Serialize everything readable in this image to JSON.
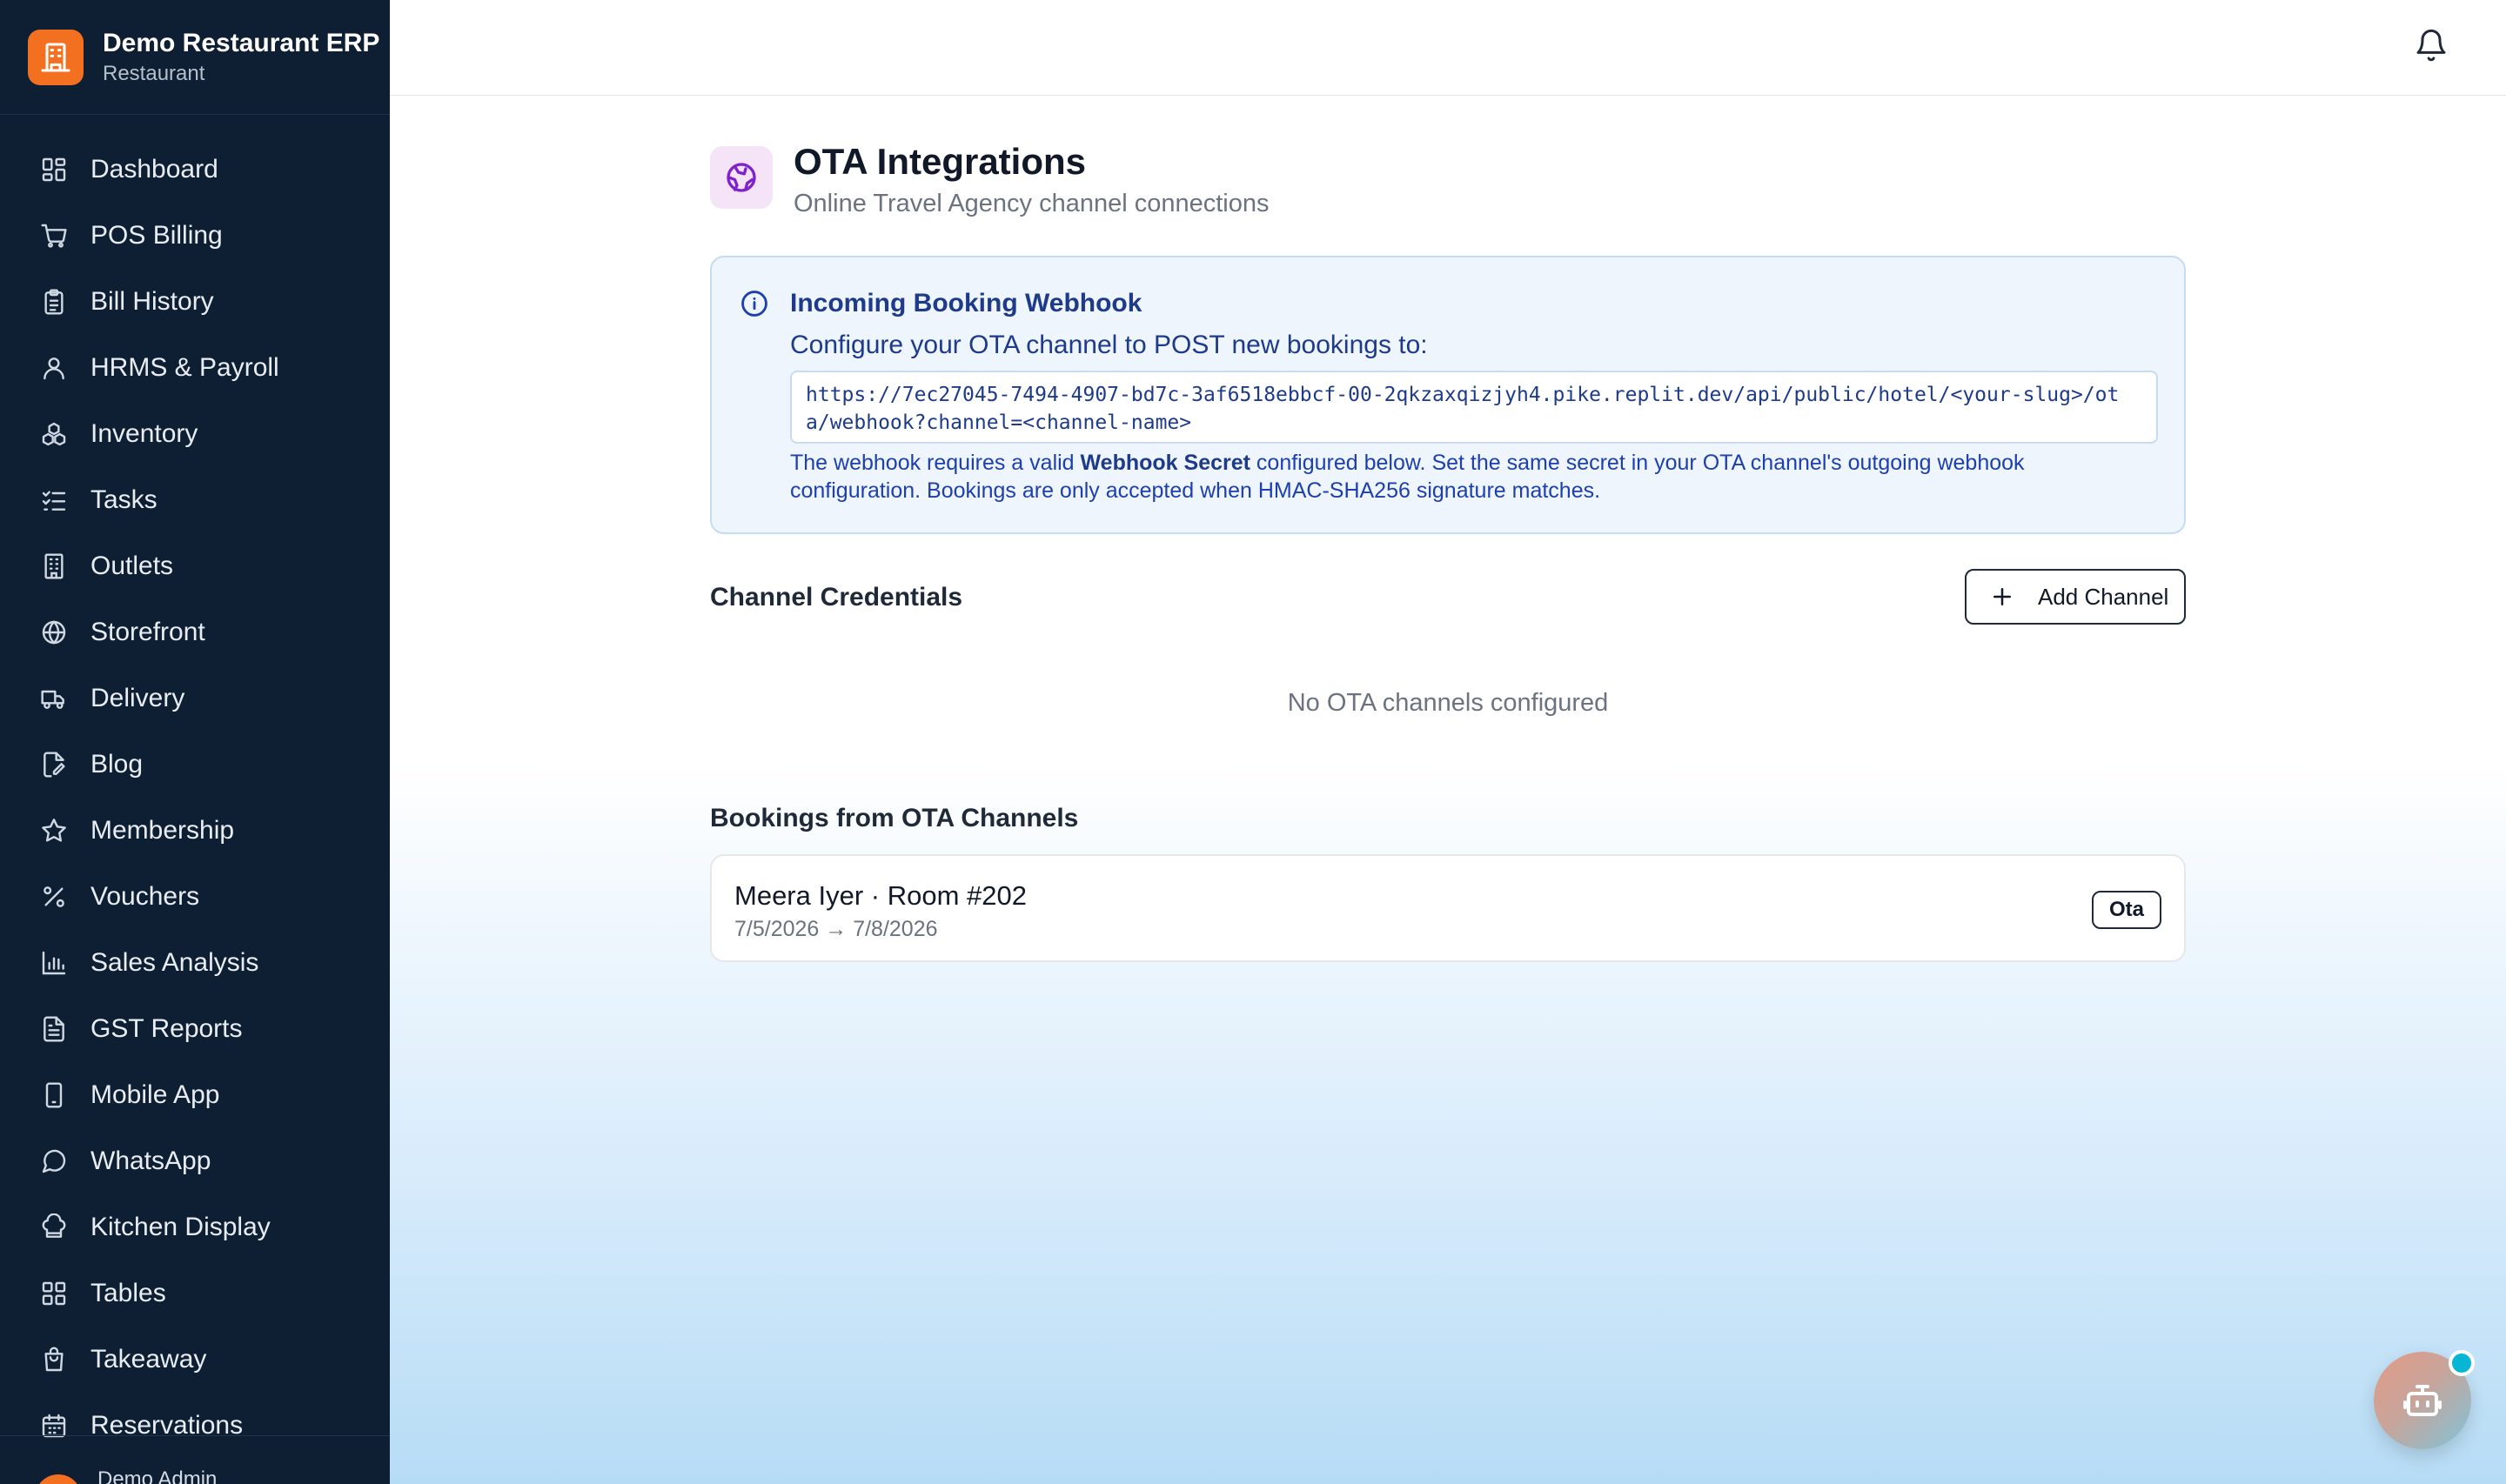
{
  "brand": {
    "name": "Demo Restaurant ERP",
    "subtitle": "Restaurant",
    "logo_icon": "building-icon",
    "accent_color": "#f37021"
  },
  "sidebar": {
    "background_color": "#0f1f33",
    "items": [
      {
        "label": "Dashboard",
        "icon": "grid-icon"
      },
      {
        "label": "POS Billing",
        "icon": "cart-icon"
      },
      {
        "label": "Bill History",
        "icon": "clipboard-icon"
      },
      {
        "label": "HRMS & Payroll",
        "icon": "user-icon"
      },
      {
        "label": "Inventory",
        "icon": "boxes-icon"
      },
      {
        "label": "Tasks",
        "icon": "checklist-icon"
      },
      {
        "label": "Outlets",
        "icon": "building-icon"
      },
      {
        "label": "Storefront",
        "icon": "globe-icon"
      },
      {
        "label": "Delivery",
        "icon": "truck-icon"
      },
      {
        "label": "Blog",
        "icon": "file-edit-icon"
      },
      {
        "label": "Membership",
        "icon": "star-icon"
      },
      {
        "label": "Vouchers",
        "icon": "percent-icon"
      },
      {
        "label": "Sales Analysis",
        "icon": "bar-chart-icon"
      },
      {
        "label": "GST Reports",
        "icon": "file-text-icon"
      },
      {
        "label": "Mobile App",
        "icon": "smartphone-icon"
      },
      {
        "label": "WhatsApp",
        "icon": "message-circle-icon"
      },
      {
        "label": "Kitchen Display",
        "icon": "chef-hat-icon"
      },
      {
        "label": "Tables",
        "icon": "grid-icon"
      },
      {
        "label": "Takeaway",
        "icon": "shopping-bag-icon"
      },
      {
        "label": "Reservations",
        "icon": "calendar-icon"
      }
    ],
    "user": {
      "name": "Demo Admin"
    }
  },
  "topbar": {
    "notification_icon": "bell-icon"
  },
  "page": {
    "title": "OTA Integrations",
    "subtitle": "Online Travel Agency channel connections",
    "icon": "ota-globe-icon"
  },
  "webhook": {
    "title": "Incoming Booking Webhook",
    "description": "Configure your OTA channel to POST new bookings to:",
    "url": "https://7ec27045-7494-4907-bd7c-3af6518ebbcf-00-2qkzaxqizjyh4.pike.replit.dev/api/public/hotel/<your-slug>/ota/webhook?channel=<channel-name>",
    "note_prefix": "The webhook requires a valid",
    "note_bold": "Webhook Secret",
    "note_suffix": "configured below. Set the same secret in your OTA channel's outgoing webhook configuration. Bookings are only accepted when HMAC-SHA256 signature matches."
  },
  "channels": {
    "title": "Channel Credentials",
    "add_button_label": "Add Channel",
    "empty_message": "No OTA channels configured"
  },
  "bookings": {
    "title": "Bookings from OTA Channels",
    "items": [
      {
        "guest_room": "Meera Iyer · Room #202",
        "dates": "7/5/2026 → 7/8/2026",
        "source": "Ota"
      }
    ]
  },
  "assistant": {
    "icon": "bot-icon"
  }
}
